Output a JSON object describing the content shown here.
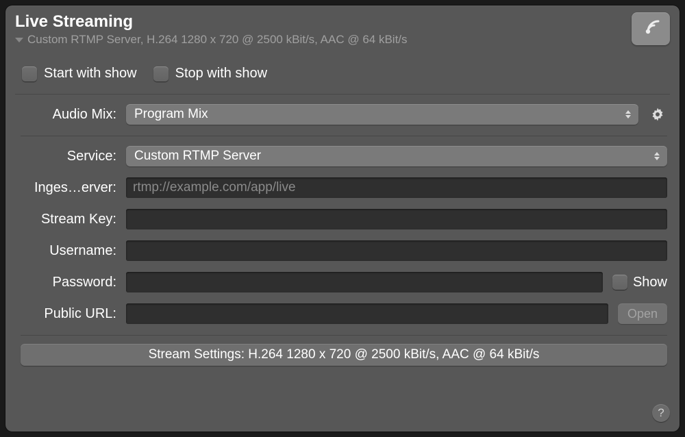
{
  "header": {
    "title": "Live Streaming",
    "subtitle": "Custom RTMP Server, H.264 1280 x 720 @ 2500 kBit/s, AAC @ 64 kBit/s",
    "stream_icon": "satellite-broadcast-icon"
  },
  "checkboxes": {
    "start_with_show": {
      "label": "Start with show",
      "checked": false
    },
    "stop_with_show": {
      "label": "Stop with show",
      "checked": false
    }
  },
  "audio_mix": {
    "label": "Audio Mix:",
    "selected": "Program Mix"
  },
  "service": {
    "label": "Service:",
    "selected": "Custom RTMP Server"
  },
  "ingest_server": {
    "label": "Inges…erver:",
    "placeholder": "rtmp://example.com/app/live",
    "value": ""
  },
  "stream_key": {
    "label": "Stream Key:",
    "value": ""
  },
  "username": {
    "label": "Username:",
    "value": ""
  },
  "password": {
    "label": "Password:",
    "value": "",
    "show_label": "Show",
    "show_checked": false
  },
  "public_url": {
    "label": "Public URL:",
    "value": "",
    "open_label": "Open"
  },
  "stream_settings_button": "Stream Settings: H.264 1280 x 720 @ 2500 kBit/s, AAC @ 64 kBit/s",
  "help_label": "?"
}
